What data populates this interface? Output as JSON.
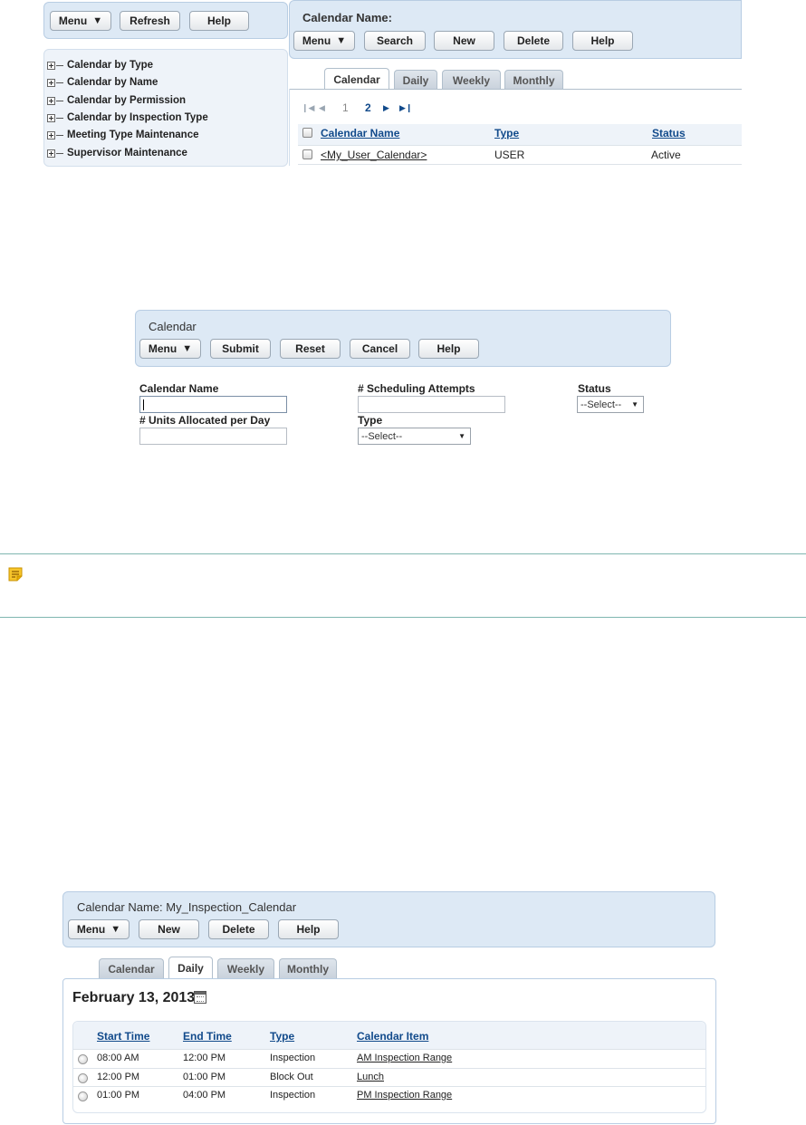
{
  "screen1": {
    "left_toolbar": {
      "menu": "Menu",
      "refresh": "Refresh",
      "help": "Help"
    },
    "tree": [
      "Calendar by Type",
      "Calendar by Name",
      "Calendar by Permission",
      "Calendar by Inspection Type",
      "Meeting Type Maintenance",
      "Supervisor Maintenance"
    ],
    "header": {
      "title": "Calendar Name:",
      "buttons": {
        "menu": "Menu",
        "search": "Search",
        "new": "New",
        "delete": "Delete",
        "help": "Help"
      }
    },
    "tabs": [
      "Calendar",
      "Daily",
      "Weekly",
      "Monthly"
    ],
    "active_tab": "Calendar",
    "pager": {
      "page1": "1",
      "page2": "2"
    },
    "table": {
      "columns": [
        "Calendar Name",
        "Type",
        "Status"
      ],
      "rows": [
        {
          "name": "<My_User_Calendar>",
          "type": "USER",
          "status": "Active"
        }
      ]
    }
  },
  "screen2": {
    "title": "Calendar",
    "buttons": {
      "menu": "Menu",
      "submit": "Submit",
      "reset": "Reset",
      "cancel": "Cancel",
      "help": "Help"
    },
    "fields": {
      "calendar_name": "Calendar Name",
      "attempts": "# Scheduling Attempts",
      "status": "Status",
      "units": "# Units Allocated per Day",
      "type": "Type"
    },
    "status_select": "--Select--",
    "type_select": "--Select--"
  },
  "note_icon": "note-icon",
  "screen3": {
    "title": "Calendar Name: My_Inspection_Calendar",
    "buttons": {
      "menu": "Menu",
      "new": "New",
      "delete": "Delete",
      "help": "Help"
    },
    "tabs": [
      "Calendar",
      "Daily",
      "Weekly",
      "Monthly"
    ],
    "active_tab": "Daily",
    "date": "February 13, 2013",
    "table": {
      "columns": [
        "Start Time",
        "End Time",
        "Type",
        "Calendar Item"
      ],
      "rows": [
        {
          "start": "08:00 AM",
          "end": "12:00 PM",
          "type": "Inspection",
          "item": "AM Inspection Range"
        },
        {
          "start": "12:00 PM",
          "end": "01:00 PM",
          "type": "Block Out",
          "item": "Lunch"
        },
        {
          "start": "01:00 PM",
          "end": "04:00 PM",
          "type": "Inspection",
          "item": "PM Inspection Range"
        }
      ]
    }
  },
  "colors": {
    "panel": "#dde9f5",
    "link": "#114a8b",
    "note_rule": "#7fb6b0",
    "note_icon": "#f0b400"
  }
}
